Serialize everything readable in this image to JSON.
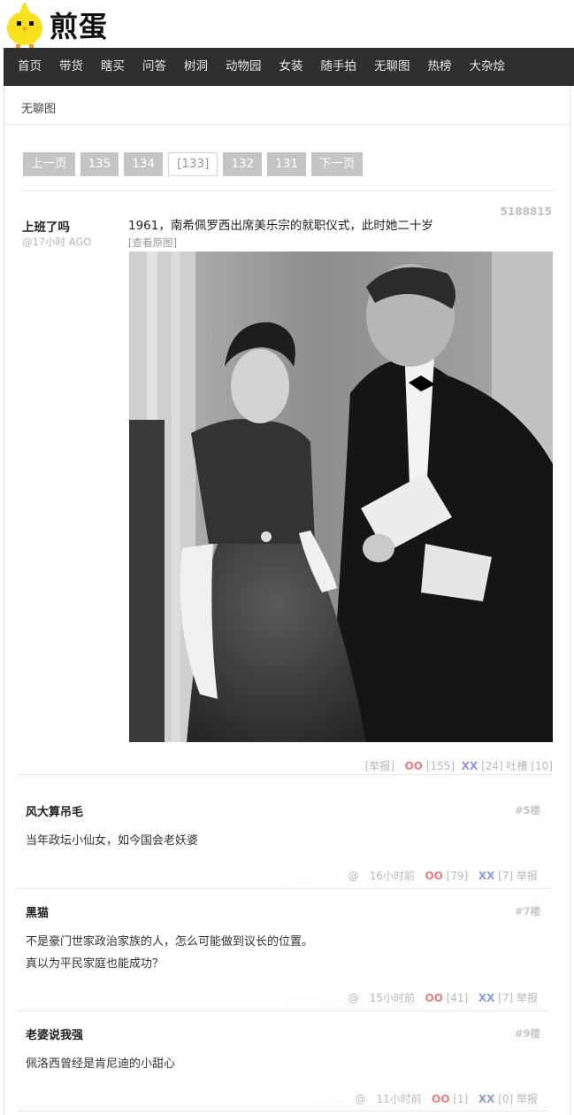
{
  "site": {
    "logo_text": "煎蛋"
  },
  "nav": [
    "首页",
    "带货",
    "瞎买",
    "问答",
    "树洞",
    "动物园",
    "女装",
    "随手拍",
    "无聊图",
    "热榜",
    "大杂烩"
  ],
  "breadcrumb": "无聊图",
  "pager": {
    "prev": "上一页",
    "pages": [
      "135",
      "134"
    ],
    "current": "[133]",
    "pages_after": [
      "132",
      "131"
    ],
    "next": "下一页"
  },
  "post": {
    "author": "上班了吗",
    "time": "@17小时 AGO",
    "id": "5188815",
    "text": "1961，南希佩罗西出席美乐宗的就职仪式，此时她二十岁",
    "view_original": "[查看原图]",
    "report": "[举报]",
    "oo_label": "OO",
    "oo_count": "[155]",
    "xx_label": "XX",
    "xx_count": "[24]",
    "tucao": "吐槽 [10]"
  },
  "comments": [
    {
      "author": "风大算吊毛",
      "floor": "#5楼",
      "lines": [
        "当年政坛小仙女，如今国会老妖婆"
      ],
      "ghost": "................",
      "time": "@　16小时前",
      "oo": "[79]",
      "xx": "[7]",
      "report": "举报"
    },
    {
      "author": "黑猫",
      "floor": "#7楼",
      "lines": [
        "不是豪门世家政治家族的人，怎么可能做到议长的位置。",
        "真以为平民家庭也能成功？"
      ],
      "ghost": "................",
      "time": "@　15小时前",
      "oo": "[41]",
      "xx": "[7]",
      "report": "举报"
    },
    {
      "author": "老婆说我强",
      "floor": "#9楼",
      "lines": [
        "佩洛西曾经是肯尼迪的小甜心"
      ],
      "ghost": "..........",
      "time": "@　11小时前",
      "oo": "[1]",
      "xx": "[0]",
      "report": "举报"
    }
  ],
  "labels": {
    "oo": "OO",
    "xx": "XX"
  }
}
